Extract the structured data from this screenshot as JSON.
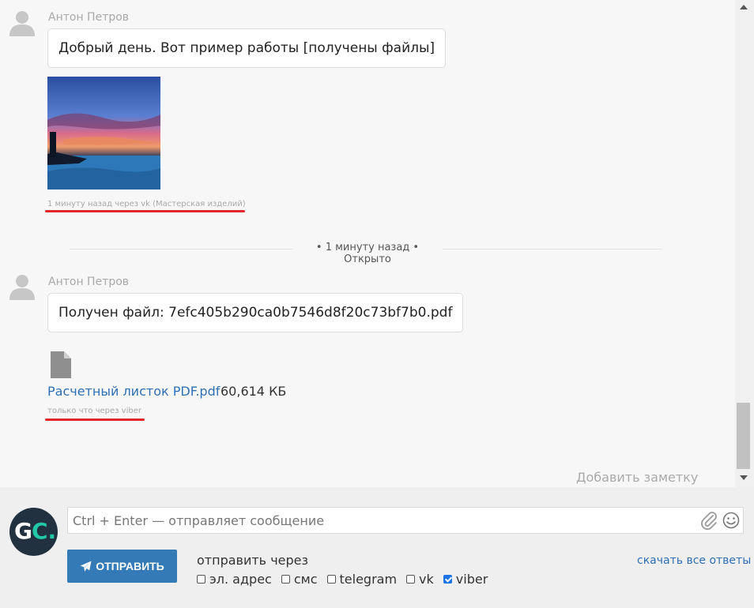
{
  "messages": [
    {
      "author": "Антон Петров",
      "text": "Добрый день. Вот пример работы [получены файлы]",
      "meta": "1 минуту назад через vk (Мастерская изделий)"
    },
    {
      "author": "Антон Петров",
      "text": "Получен файл: 7efc405b290ca0b7546d8f20c73bf7b0.pdf",
      "file_name": "Расчетный листок PDF.pdf",
      "file_size": "60,614 КБ",
      "meta": "только что через viber"
    }
  ],
  "divider": {
    "text": "• 1 минуту назад • Открыто"
  },
  "add_note": "Добавить заметку",
  "composer": {
    "placeholder": "Ctrl + Enter — отправляет сообщение",
    "send_label": "ОТПРАВИТЬ",
    "send_via_label": "отправить через",
    "channels": [
      {
        "label": "эл. адрес",
        "checked": false
      },
      {
        "label": "смс",
        "checked": false
      },
      {
        "label": "telegram",
        "checked": false
      },
      {
        "label": "vk",
        "checked": false
      },
      {
        "label": "viber",
        "checked": true
      }
    ],
    "download_all": "скачать все ответы",
    "logo_g": "G",
    "logo_c": "C."
  },
  "colors": {
    "accent": "#337ab7",
    "link": "#2f6fb6",
    "highlight": "#e3262b",
    "logo_bg": "#213140",
    "logo_accent": "#22c7a8"
  },
  "icons": [
    "user-avatar-icon",
    "file-icon",
    "paperclip-icon",
    "smile-icon",
    "paper-plane-icon"
  ]
}
